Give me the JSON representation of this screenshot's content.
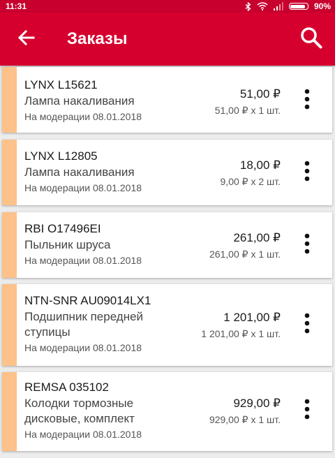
{
  "status_bar": {
    "time": "11:31",
    "battery_percent": "90%",
    "battery_level": 0.9,
    "icons": [
      "bluetooth-icon",
      "wifi-icon",
      "signal-icon",
      "battery-icon"
    ]
  },
  "app_bar": {
    "title": "Заказы",
    "back_icon": "arrow-left-icon",
    "search_icon": "search-icon",
    "background": "#d6002f"
  },
  "accent_stripe_color": "#fcc28a",
  "orders": [
    {
      "title": "LYNX L15621",
      "description": "Лампа накаливания",
      "status": "На модерации 08.01.2018",
      "price": "51,00 ₽",
      "unit_line": "51,00 ₽ x 1 шт."
    },
    {
      "title": "LYNX L12805",
      "description": "Лампа накаливания",
      "status": "На модерации 08.01.2018",
      "price": "18,00 ₽",
      "unit_line": "9,00 ₽ x 2 шт."
    },
    {
      "title": "RBI O17496EI",
      "description": "Пыльник шруса",
      "status": "На модерации 08.01.2018",
      "price": "261,00 ₽",
      "unit_line": "261,00 ₽ x 1 шт."
    },
    {
      "title": "NTN-SNR AU09014LX1",
      "description": "Подшипник передней ступицы",
      "status": "На модерации 08.01.2018",
      "price": "1 201,00 ₽",
      "unit_line": "1 201,00 ₽ x 1 шт."
    },
    {
      "title": "REMSA 035102",
      "description": "Колодки тормозные дисковые, комплект",
      "status": "На модерации 08.01.2018",
      "price": "929,00 ₽",
      "unit_line": "929,00 ₽ x 1 шт."
    }
  ]
}
